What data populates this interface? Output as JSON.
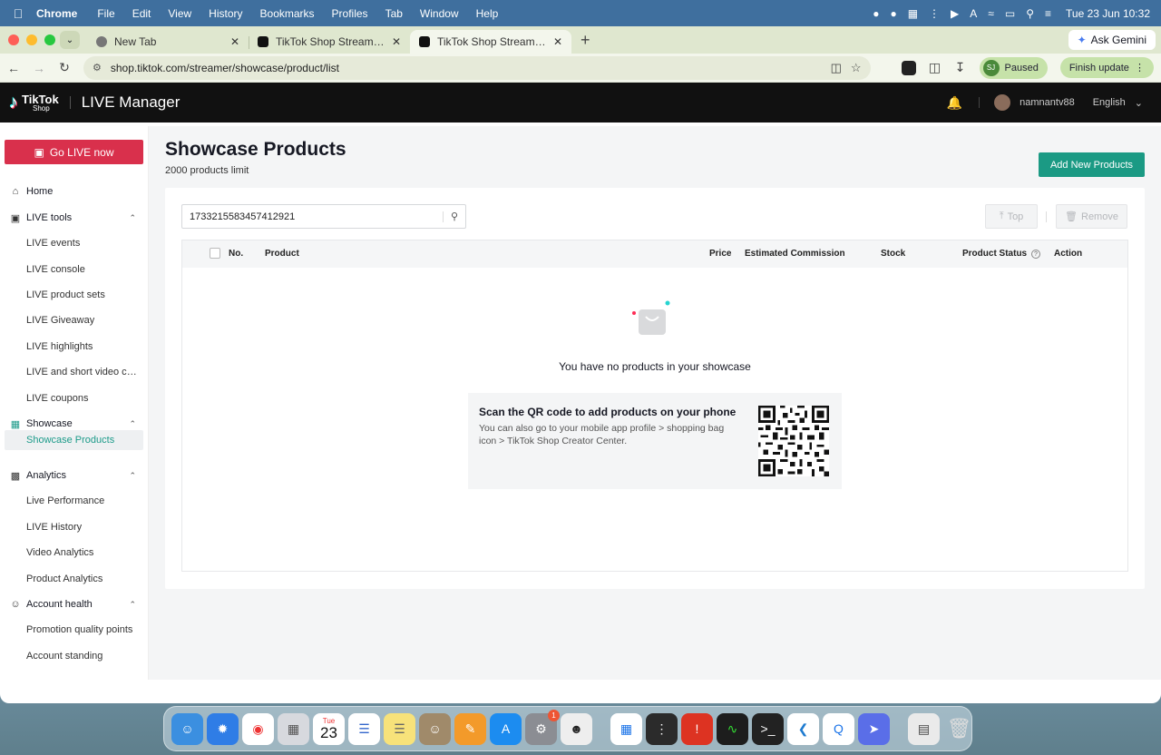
{
  "menubar": {
    "app": "Chrome",
    "items": [
      "File",
      "Edit",
      "View",
      "History",
      "Bookmarks",
      "Profiles",
      "Tab",
      "Window",
      "Help"
    ],
    "datetime": "Tue 23 Jun  10:32"
  },
  "browser": {
    "tabs": [
      {
        "label": "New Tab"
      },
      {
        "label": "TikTok Shop Streamer Deskto"
      },
      {
        "label": "TikTok Shop Streamer Deskto"
      }
    ],
    "ask_gemini": "Ask Gemini",
    "url": "shop.tiktok.com/streamer/showcase/product/list",
    "profile_initials": "SJ",
    "profile_status": "Paused",
    "finish_update": "Finish update"
  },
  "header": {
    "logo_line1": "TikTok",
    "logo_line2": "Shop",
    "title": "LIVE Manager",
    "username": "namnantv88",
    "language": "English"
  },
  "sidebar": {
    "go_live": "Go LIVE now",
    "home": "Home",
    "live_tools": "LIVE tools",
    "live_tools_items": [
      "LIVE events",
      "LIVE console",
      "LIVE product sets",
      "LIVE Giveaway",
      "LIVE highlights",
      "LIVE and short video campaigns",
      "LIVE coupons"
    ],
    "showcase": "Showcase",
    "showcase_items": [
      "Showcase Products"
    ],
    "analytics": "Analytics",
    "analytics_items": [
      "Live Performance",
      "LIVE History",
      "Video Analytics",
      "Product Analytics"
    ],
    "account_health": "Account health",
    "account_health_items": [
      "Promotion quality points",
      "Account standing"
    ]
  },
  "page": {
    "title": "Showcase Products",
    "subtitle": "2000 products limit",
    "add_button": "Add New Products",
    "search_value": "1733215583457412921",
    "top_button": "Top",
    "remove_button": "Remove",
    "columns": {
      "no": "No.",
      "product": "Product",
      "price": "Price",
      "commission": "Estimated Commission",
      "stock": "Stock",
      "status": "Product Status",
      "action": "Action"
    },
    "empty_text": "You have no products in your showcase",
    "qr_title": "Scan the QR code to add products on your phone",
    "qr_desc": "You can also go to your mobile app profile > shopping bag icon > TikTok Shop Creator Center."
  },
  "dock": {
    "calendar_month": "Tue",
    "calendar_day": "23",
    "settings_badge": "1"
  },
  "colors": {
    "accent": "#1b9a84",
    "golive": "#d9304c",
    "header_bg": "#111111"
  }
}
